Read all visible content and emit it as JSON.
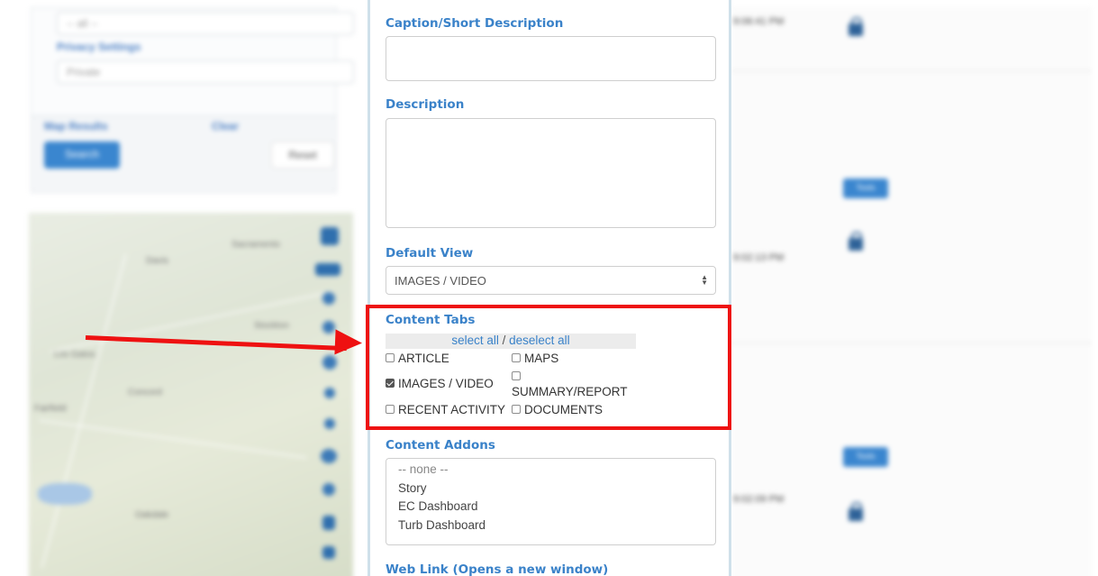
{
  "background": {
    "filter_select": "-- all --",
    "privacy_label": "Privacy Settings",
    "privacy_select": "Private",
    "map_results_label": "Map Results",
    "clear_label": "Clear",
    "search_button": "Search",
    "reset_button": "Reset",
    "map_towns": [
      "Sacramento",
      "Davis",
      "Los Gatos",
      "Fairfield",
      "Concord",
      "Oakdale",
      "Stockton"
    ],
    "timestamps": [
      "9:06:41 PM",
      "9:02:13 PM",
      "9:02:09 PM"
    ],
    "tag_label": "Tools",
    "colors": {
      "accent_blue": "#3a82c9",
      "map_tool": "#2f6fae",
      "lock": "#2e6298"
    }
  },
  "form": {
    "caption_label": "Caption/Short Description",
    "caption_value": "",
    "description_label": "Description",
    "description_value": "",
    "default_view_label": "Default View",
    "default_view_value": "IMAGES / VIDEO",
    "content_tabs_label": "Content Tabs",
    "select_all": "select all",
    "separator": "/",
    "deselect_all": "deselect all",
    "tabs": [
      {
        "label": "ARTICLE",
        "checked": false
      },
      {
        "label": "MAPS",
        "checked": false
      },
      {
        "label": "IMAGES / VIDEO",
        "checked": true
      },
      {
        "label": "SUMMARY/REPORT",
        "checked": false
      },
      {
        "label": "RECENT ACTIVITY",
        "checked": false
      },
      {
        "label": "DOCUMENTS",
        "checked": false
      }
    ],
    "content_addons_label": "Content Addons",
    "addons_options": [
      "-- none --",
      "Story",
      "EC Dashboard",
      "Turb Dashboard"
    ],
    "web_link_label": "Web Link (Opens a new window)"
  },
  "annotation": {
    "highlight_color": "#ee1111"
  }
}
